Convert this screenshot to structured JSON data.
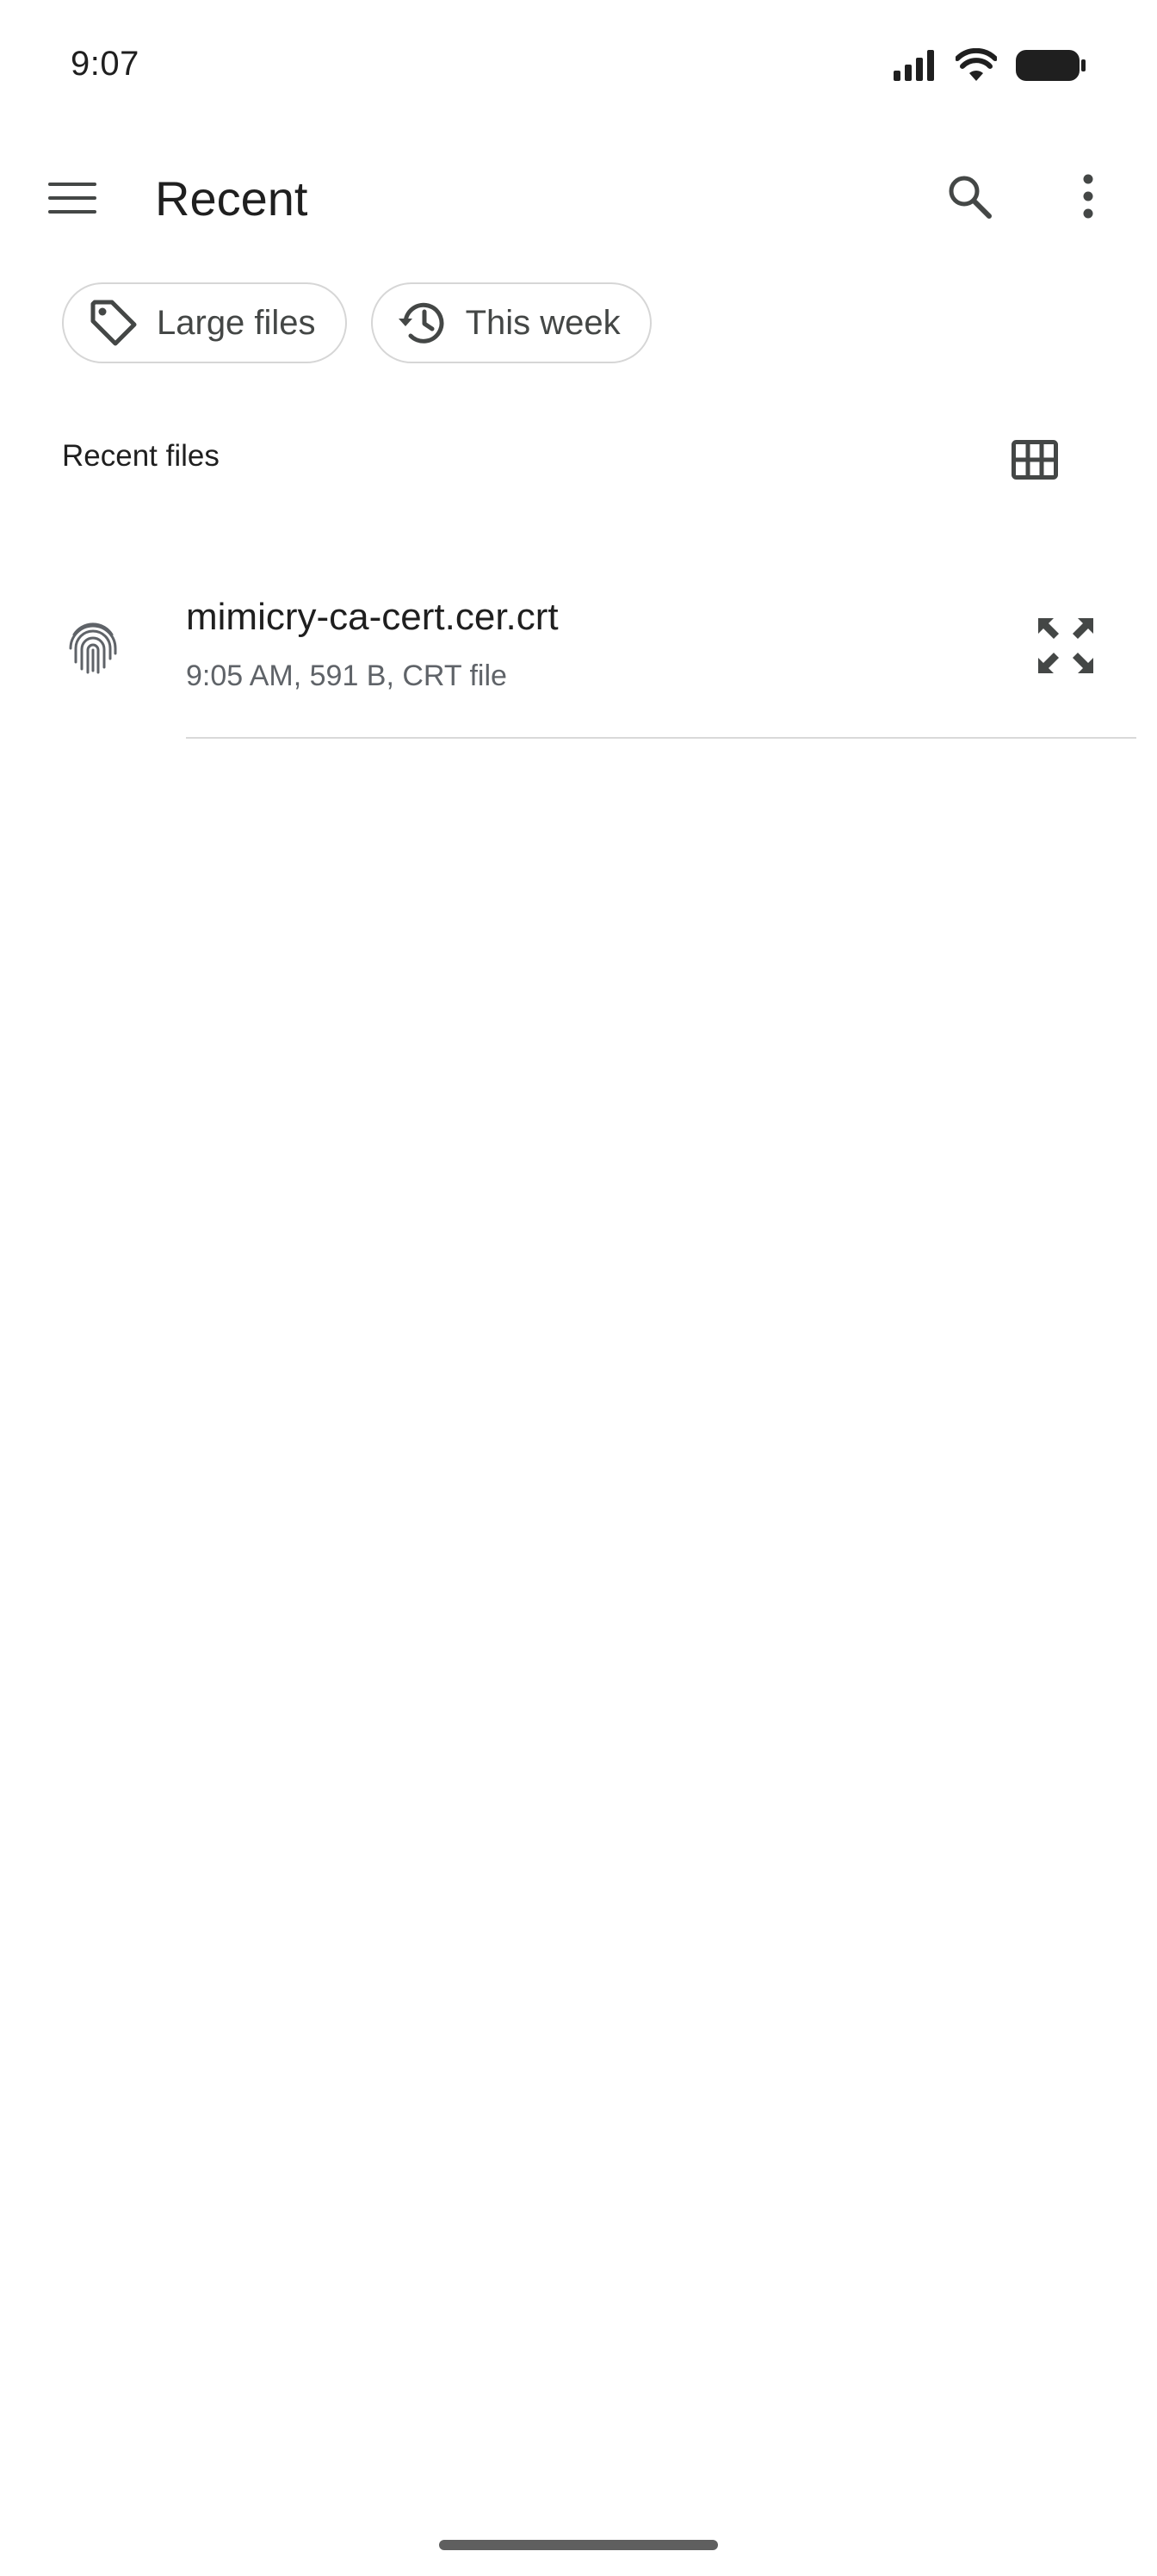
{
  "status_bar": {
    "time": "9:07"
  },
  "app_bar": {
    "title": "Recent"
  },
  "chips": [
    {
      "label": "Large files",
      "icon": "tag-icon"
    },
    {
      "label": "This week",
      "icon": "history-icon"
    }
  ],
  "section": {
    "title": "Recent files"
  },
  "files": [
    {
      "name": "mimicry-ca-cert.cer.crt",
      "meta": "9:05 AM, 591 B, CRT file",
      "icon": "fingerprint-icon"
    }
  ],
  "colors": {
    "icon": "#444746",
    "text_primary": "#1f1f1f",
    "text_secondary": "#5f6368",
    "chip_border": "#d6d6d6",
    "divider": "#d9d9d9"
  }
}
